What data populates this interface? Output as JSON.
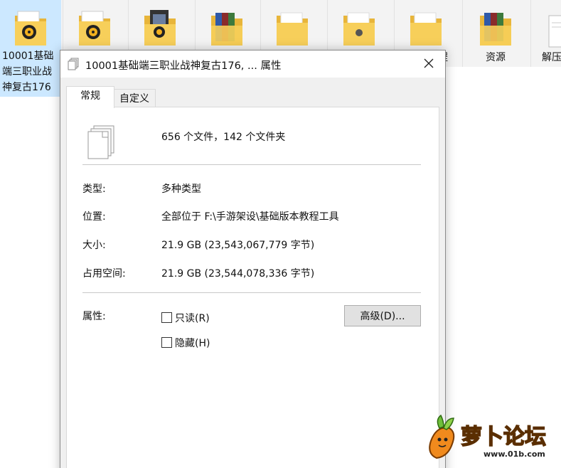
{
  "explorer": {
    "items": [
      {
        "label": "10001基础端三职业战神复古176",
        "selected": true,
        "icon": "folder-media-icon"
      },
      {
        "label": "",
        "icon": "folder-media-icon"
      },
      {
        "label": "",
        "icon": "folder-book-icon"
      },
      {
        "label": "",
        "icon": "folder-archive-icon"
      },
      {
        "label": "",
        "icon": "folder-icon"
      },
      {
        "label": "",
        "icon": "folder-docs-icon"
      },
      {
        "label": "程",
        "icon": "folder-icon"
      },
      {
        "label": "资源",
        "icon": "folder-archive-icon"
      },
      {
        "label": "解压",
        "icon": "document-icon"
      }
    ]
  },
  "dialog": {
    "title": "10001基础端三职业战神复古176, ... 属性",
    "tabs": [
      {
        "label": "常规",
        "active": true
      },
      {
        "label": "自定义",
        "active": false
      }
    ],
    "summary": "656 个文件，142 个文件夹",
    "rows": {
      "type_label": "类型:",
      "type_value": "多种类型",
      "location_label": "位置:",
      "location_value": "全部位于 F:\\手游架设\\基础版本教程工具",
      "size_label": "大小:",
      "size_value": "21.9 GB (23,543,067,779 字节)",
      "disk_label": "占用空间:",
      "disk_value": "21.9 GB (23,544,078,336 字节)"
    },
    "attributes": {
      "label": "属性:",
      "readonly_label": "只读(R)",
      "readonly_checked": false,
      "hidden_label": "隐藏(H)",
      "hidden_checked": false,
      "advanced_label": "高级(D)..."
    }
  },
  "watermark": {
    "text": "萝卜论坛",
    "url": "www.01b.com"
  },
  "colors": {
    "selection": "#cce8ff",
    "dialog_bg": "#f0f0f0",
    "folder": "#f5c342"
  }
}
